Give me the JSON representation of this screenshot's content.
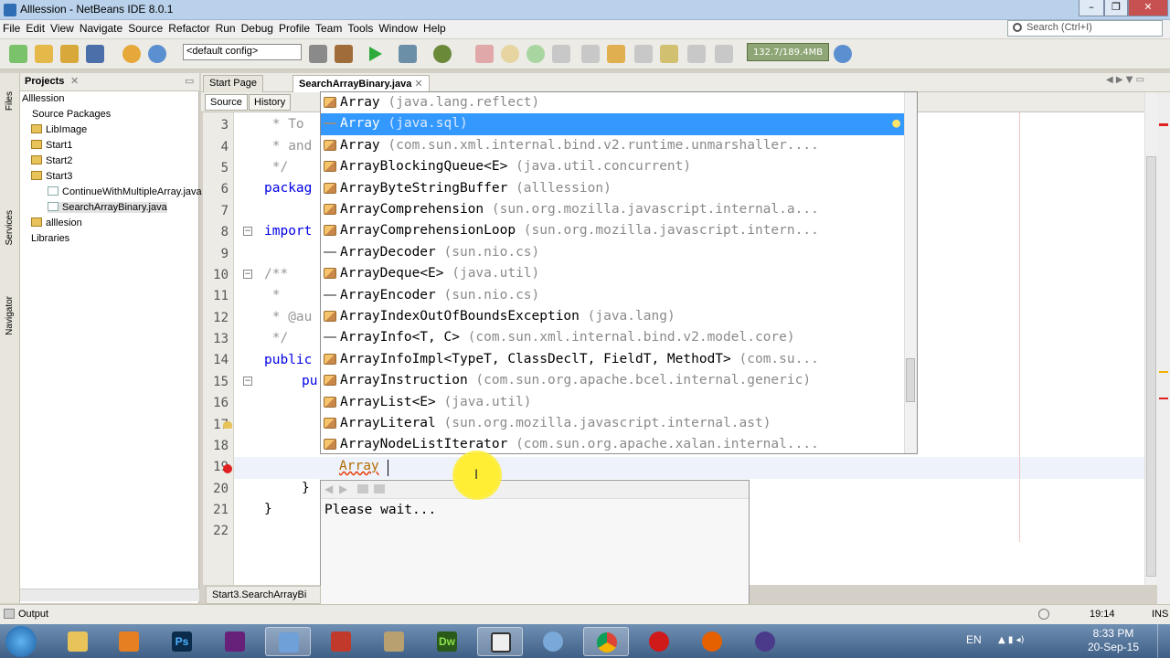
{
  "window": {
    "title": "Alllession - NetBeans IDE 8.0.1",
    "min": "–",
    "max": "❐",
    "close": "✕"
  },
  "menu": [
    "File",
    "Edit",
    "View",
    "Navigate",
    "Source",
    "Refactor",
    "Run",
    "Debug",
    "Profile",
    "Team",
    "Tools",
    "Window",
    "Help"
  ],
  "search": {
    "placeholder": "Search (Ctrl+I)"
  },
  "toolbar": {
    "config": "<default config>",
    "memory": "132.7/189.4MB"
  },
  "side_tabs": [
    "Files",
    "Services",
    "Navigator"
  ],
  "projects": {
    "title": "Projects",
    "items": [
      {
        "label": "Alllession"
      },
      {
        "label": "Source Packages"
      },
      {
        "label": "LibImage"
      },
      {
        "label": "Start1"
      },
      {
        "label": "Start2"
      },
      {
        "label": "Start3"
      },
      {
        "label": "ContinueWithMultipleArray.java"
      },
      {
        "label": "SearchArrayBinary.java"
      },
      {
        "label": "alllesion"
      },
      {
        "label": "Libraries"
      }
    ]
  },
  "tabs": [
    {
      "label": "Start Page"
    },
    {
      "label": "SearchArrayBinary.java"
    }
  ],
  "source_bar": {
    "source": "Source",
    "history": "History"
  },
  "line_numbers": [
    "3",
    "4",
    "5",
    "6",
    "7",
    "8",
    "9",
    "10",
    "11",
    "12",
    "13",
    "14",
    "15",
    "16",
    "17",
    "18",
    "19",
    "20",
    "21",
    "22"
  ],
  "code": {
    "l3": " * To",
    "l4": " * and",
    "l5": " */",
    "l6": "packag",
    "l8": "import",
    "l10": "/**",
    "l11": " *",
    "l12": " * @au",
    "l13": " */",
    "l14": "public",
    "l15": "pu",
    "l20": "}",
    "l21": "}",
    "typed": "Array"
  },
  "completion": [
    {
      "name": "Array",
      "pkg": "(java.lang.reflect)"
    },
    {
      "name": "Array",
      "pkg": "(java.sql)"
    },
    {
      "name": "Array",
      "pkg": "(com.sun.xml.internal.bind.v2.runtime.unmarshaller...."
    },
    {
      "name": "ArrayBlockingQueue<E>",
      "pkg": "(java.util.concurrent)"
    },
    {
      "name": "ArrayByteStringBuffer",
      "pkg": "(alllession)"
    },
    {
      "name": "ArrayComprehension",
      "pkg": "(sun.org.mozilla.javascript.internal.a..."
    },
    {
      "name": "ArrayComprehensionLoop",
      "pkg": "(sun.org.mozilla.javascript.intern..."
    },
    {
      "name": "ArrayDecoder",
      "pkg": "(sun.nio.cs)"
    },
    {
      "name": "ArrayDeque<E>",
      "pkg": "(java.util)"
    },
    {
      "name": "ArrayEncoder",
      "pkg": "(sun.nio.cs)"
    },
    {
      "name": "ArrayIndexOutOfBoundsException",
      "pkg": "(java.lang)"
    },
    {
      "name": "ArrayInfo<T, C>",
      "pkg": "(com.sun.xml.internal.bind.v2.model.core)"
    },
    {
      "name": "ArrayInfoImpl<TypeT, ClassDeclT, FieldT, MethodT>",
      "pkg": "(com.su..."
    },
    {
      "name": "ArrayInstruction",
      "pkg": "(com.sun.org.apache.bcel.internal.generic)"
    },
    {
      "name": "ArrayList<E>",
      "pkg": "(java.util)"
    },
    {
      "name": "ArrayLiteral",
      "pkg": "(sun.org.mozilla.javascript.internal.ast)"
    },
    {
      "name": "ArrayNodeListIterator",
      "pkg": "(com.sun.org.apache.xalan.internal...."
    }
  ],
  "doc_popup": {
    "text": "Please wait..."
  },
  "status": {
    "output": "Output",
    "navigator_tab": "Start3.SearchArrayBi",
    "position": "19:14",
    "mode": "INS"
  },
  "taskbar": {
    "lang": "EN",
    "time": "8:33 PM",
    "date": "20-Sep-15",
    "dw": "Dw",
    "ps": "Ps"
  }
}
